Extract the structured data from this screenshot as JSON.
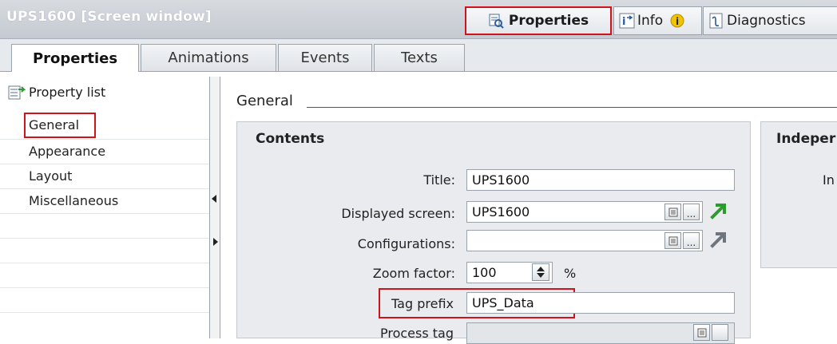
{
  "window": {
    "title": "UPS1600 [Screen window]"
  },
  "top_tabs": {
    "properties": "Properties",
    "info": "Info",
    "diagnostics": "Diagnostics"
  },
  "sub_tabs": [
    "Properties",
    "Animations",
    "Events",
    "Texts"
  ],
  "left_panel": {
    "header": "Property list",
    "items": [
      "General",
      "Appearance",
      "Layout",
      "Miscellaneous"
    ]
  },
  "main": {
    "section_title": "General",
    "contents_group": {
      "title": "Contents",
      "fields": {
        "title_label": "Title:",
        "title_value": "UPS1600",
        "displayed_screen_label": "Displayed screen:",
        "displayed_screen_value": "UPS1600",
        "configurations_label": "Configurations:",
        "configurations_value": "",
        "zoom_label": "Zoom factor:",
        "zoom_value": "100",
        "zoom_unit": "%",
        "tag_prefix_label": "Tag prefix",
        "tag_prefix_value": "UPS_Data",
        "process_tag_label": "Process tag",
        "ellipsis": "..."
      }
    },
    "independent_group": {
      "title": "Indeper",
      "label_partial": "In"
    }
  },
  "colors": {
    "highlight_red": "#d0121b",
    "arrow_green": "#2a9d2a",
    "arrow_gray": "#6f757c"
  }
}
